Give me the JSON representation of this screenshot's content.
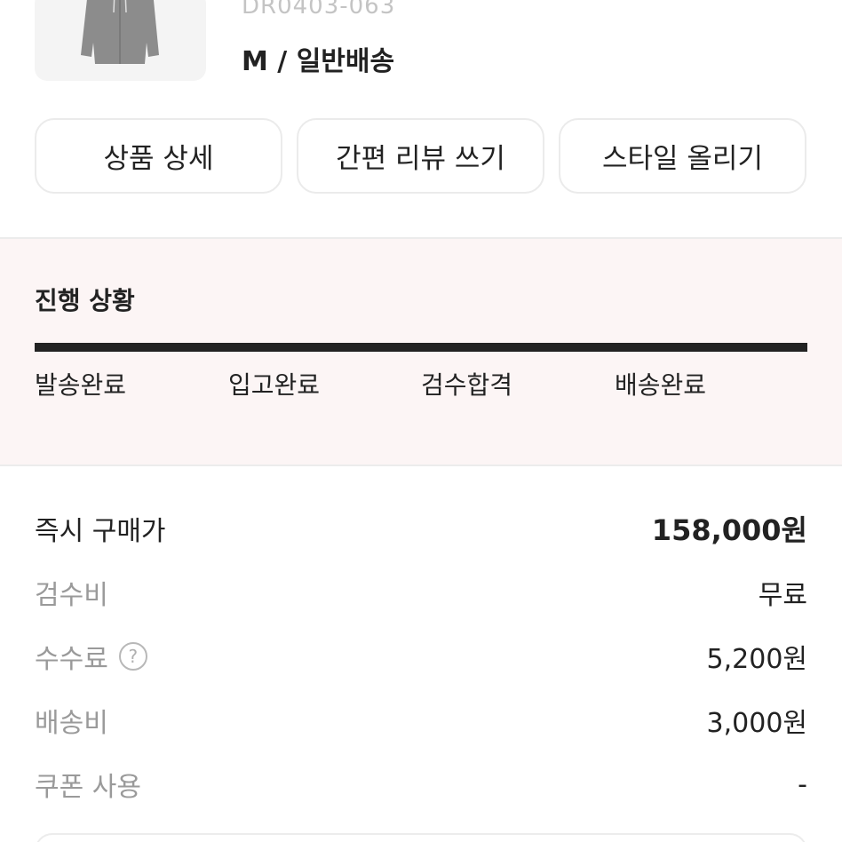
{
  "product": {
    "code": "DR0403-063",
    "option": "M / 일반배송",
    "image_icon": "hoodie-image"
  },
  "actions": {
    "detail": "상품 상세",
    "review": "간편 리뷰 쓰기",
    "style": "스타일 올리기"
  },
  "progress": {
    "title": "진행 상황",
    "steps": [
      "발송완료",
      "입고완료",
      "검수합격",
      "배송완료"
    ],
    "completed_fraction": 1.0
  },
  "price": {
    "buy_now_label": "즉시 구매가",
    "buy_now_value": "158,000원",
    "inspection_label": "검수비",
    "inspection_value": "무료",
    "fee_label": "수수료",
    "fee_help": "?",
    "fee_value": "5,200원",
    "shipping_label": "배송비",
    "shipping_value": "3,000원",
    "coupon_label": "쿠폰 사용",
    "coupon_value": "-"
  },
  "colors": {
    "progress_bg": "#fcf5f5",
    "progress_bar": "#222222",
    "muted_text": "#9a9a9a"
  }
}
